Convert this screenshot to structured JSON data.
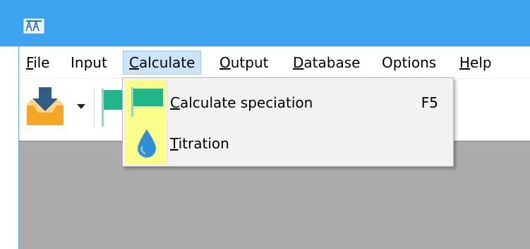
{
  "menubar": {
    "items": [
      {
        "mnemonic": "F",
        "rest": "ile"
      },
      {
        "mnemonic": "",
        "rest": "Input"
      },
      {
        "mnemonic": "C",
        "rest": "alculate"
      },
      {
        "mnemonic": "O",
        "rest": "utput"
      },
      {
        "mnemonic": "D",
        "rest": "atabase"
      },
      {
        "mnemonic": "",
        "rest": "Options"
      },
      {
        "mnemonic": "H",
        "rest": "elp"
      }
    ]
  },
  "calculate_menu": {
    "items": [
      {
        "mnemonic": "C",
        "rest": "alculate speciation",
        "shortcut": "F5",
        "icon": "green-flag-icon"
      },
      {
        "mnemonic": "T",
        "rest": "itration",
        "shortcut": "",
        "icon": "water-drop-icon"
      }
    ]
  },
  "colors": {
    "titlebar": "#3ea3f1",
    "menu_highlight": "#cce4f7",
    "icon_column": "#fcfc8b",
    "flag": "#21b58a",
    "drop": "#2f8fd6",
    "content_bg": "#ababab"
  }
}
